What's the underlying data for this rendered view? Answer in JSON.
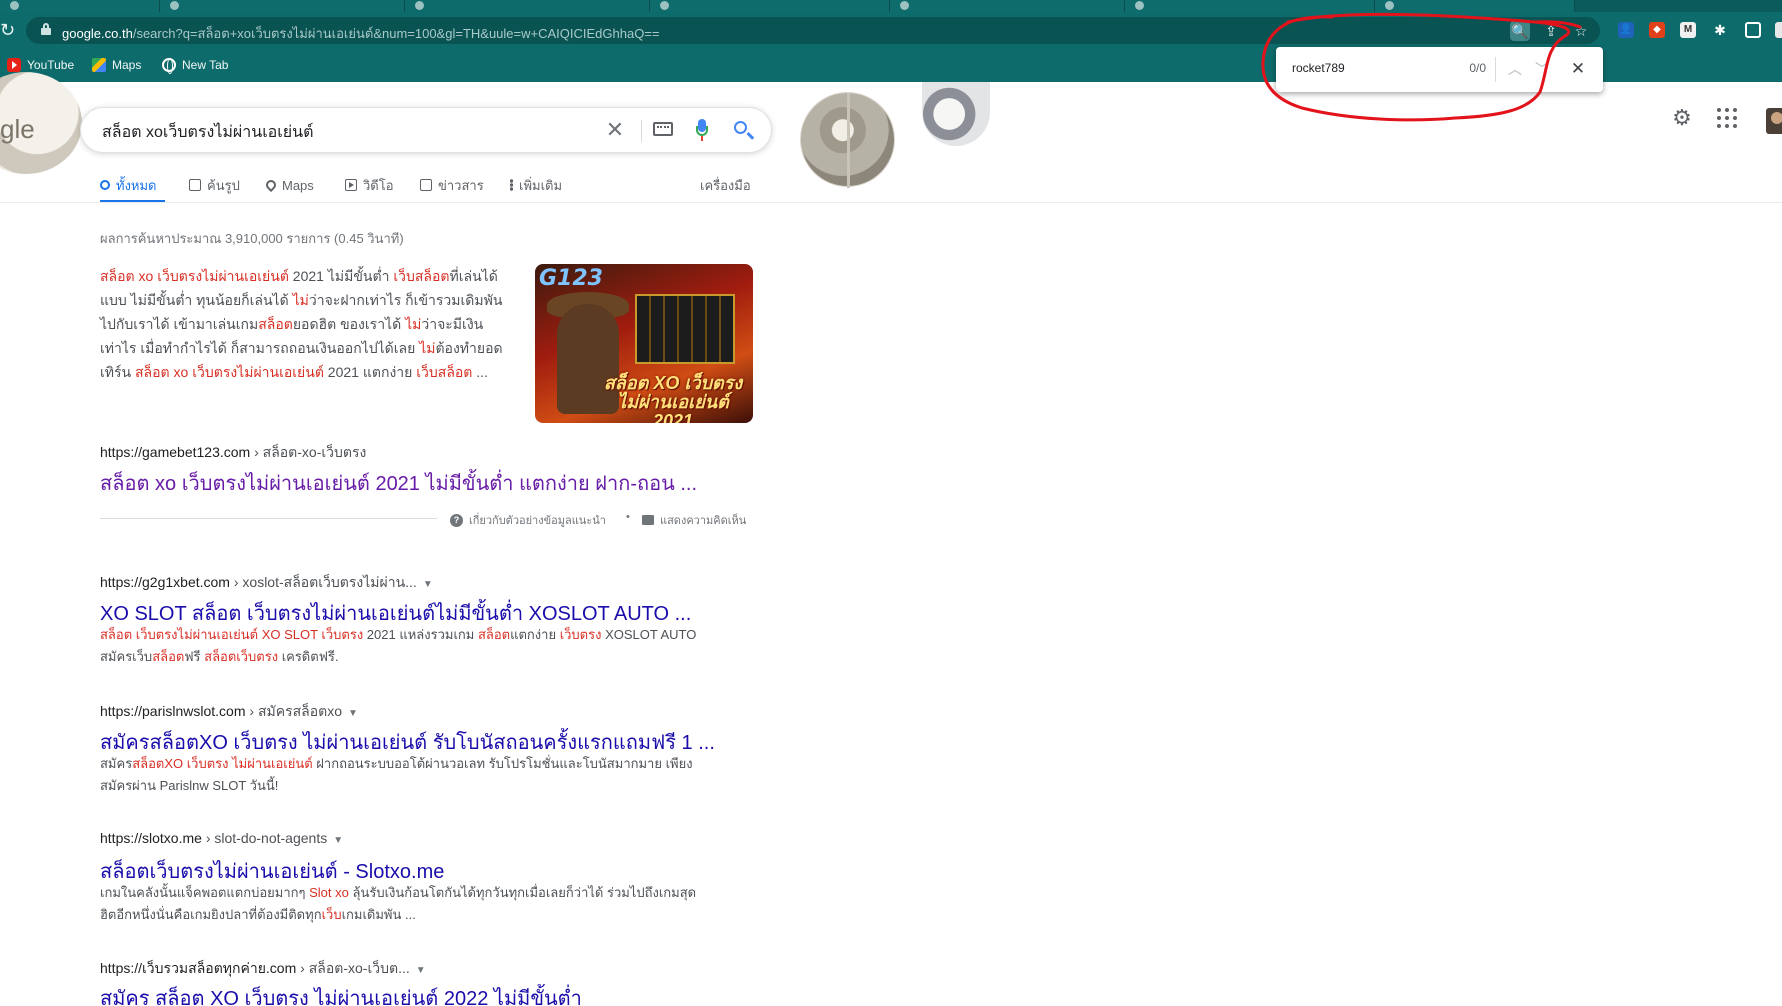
{
  "browser": {
    "url_host": "google.co.th",
    "url_rest": "/search?q=สล็อต+xoเว็บตรงไม่ผ่านเอเย่นต์&num=100&gl=TH&uule=w+CAIQICIEdGhhaQ==",
    "bookmarks": [
      {
        "label": "YouTube",
        "icon": "youtube-icon"
      },
      {
        "label": "Maps",
        "icon": "maps-icon"
      },
      {
        "label": "New Tab",
        "icon": "globe-icon"
      }
    ]
  },
  "findbar": {
    "query": "rocket789",
    "count": "0/0"
  },
  "search": {
    "query": "สล็อต xoเว็บตรงไม่ผ่านเอเย่นต์",
    "tabs": [
      {
        "label": "ทั้งหมด",
        "icon": "search-icon",
        "active": true
      },
      {
        "label": "ค้นรูป",
        "icon": "image-icon"
      },
      {
        "label": "Maps",
        "icon": "map-pin-icon"
      },
      {
        "label": "วิดีโอ",
        "icon": "video-icon"
      },
      {
        "label": "ข่าวสาร",
        "icon": "news-icon"
      },
      {
        "label": "เพิ่มเติม",
        "icon": "more-dots-icon"
      }
    ],
    "tools_label": "เครื่องมือ",
    "stats": "ผลการค้นหาประมาณ 3,910,000 รายการ (0.45 วินาที)"
  },
  "featured": {
    "snippet_segments": [
      {
        "t": "สล็อต xo เว็บตรงไม่ผ่านเอเย่นต์",
        "hl": true
      },
      {
        "t": " 2021 ไม่มีขั้นต่ำ ",
        "hl": false
      },
      {
        "t": "เว็บสล็อต",
        "hl": true
      },
      {
        "t": "ที่เล่นได้แบบ ไม่มีขั้นต่ำ ทุนน้อยก็เล่นได้ ",
        "hl": false
      },
      {
        "t": "ไม่",
        "hl": true
      },
      {
        "t": "ว่าจะฝากเท่าไร ก็เข้ารวมเดิมพันไปกับเราได้ เข้ามาเล่นเกม",
        "hl": false
      },
      {
        "t": "สล็อต",
        "hl": true
      },
      {
        "t": "ยอดฮิต ของเราได้ ",
        "hl": false
      },
      {
        "t": "ไม่",
        "hl": true
      },
      {
        "t": "ว่าจะมีเงินเท่าไร เมื่อทำกำไรได้ ก็สามารถถอนเงินออกไปได้เลย ",
        "hl": false
      },
      {
        "t": "ไม่",
        "hl": true
      },
      {
        "t": "ต้องทำยอดเทิร์น ",
        "hl": false
      },
      {
        "t": "สล็อต xo เว็บตรงไม่ผ่านเอเย่นต์",
        "hl": true
      },
      {
        "t": " 2021 แตกง่าย ",
        "hl": false
      },
      {
        "t": "เว็บสล็อต",
        "hl": true
      },
      {
        "t": " ...",
        "hl": false
      }
    ],
    "thumb_brand": "G123",
    "thumb_title": "สล็อต XO เว็บตรงไม่ผ่านเอเย่นต์ 2021",
    "cite_host": "https://gamebet123.com",
    "cite_path": " › สล็อต-xo-เว็บตรง",
    "title": "สล็อต xo เว็บตรงไม่ผ่านเอเย่นต์ 2021 ไม่มีขั้นต่ำ แตกง่าย ฝาก-ถอน ...",
    "about_label": "เกี่ยวกับตัวอย่างข้อมูลแนะนำ",
    "feedback_label": "แสดงความคิดเห็น",
    "dot": "•"
  },
  "results": [
    {
      "cite_host": "https://g2g1xbet.com",
      "cite_path": " › xoslot-สล็อตเว็บตรงไม่ผ่าน...",
      "title": "XO SLOT สล็อต เว็บตรงไม่ผ่านเอเย่นต์ไม่มีขั้นต่ำ XOSLOT AUTO ...",
      "desc": [
        {
          "t": "สล็อต เว็บตรงไม่ผ่านเอเย่นต์ XO SLOT เว็บตรง",
          "hl": true
        },
        {
          "t": " 2021 แหล่งรวมเกม ",
          "hl": false
        },
        {
          "t": "สล็อต",
          "hl": true
        },
        {
          "t": "แตกง่าย ",
          "hl": false
        },
        {
          "t": "เว็บตรง",
          "hl": true
        },
        {
          "t": " XOSLOT AUTO สมัครเว็บ",
          "hl": false
        },
        {
          "t": "สล็อต",
          "hl": true
        },
        {
          "t": "ฟรี ",
          "hl": false
        },
        {
          "t": "สล็อตเว็บตรง",
          "hl": true
        },
        {
          "t": " เครดิตฟรี.",
          "hl": false
        }
      ]
    },
    {
      "cite_host": "https://parislnwslot.com",
      "cite_path": " › สมัครสล็อตxo",
      "title": "สมัครสล็อตXO เว็บตรง ไม่ผ่านเอเย่นต์ รับโบนัสถอนครั้งแรกแถมฟรี 1 ...",
      "desc": [
        {
          "t": "สมัคร",
          "hl": false
        },
        {
          "t": "สล็อตXO เว็บตรง ไม่ผ่านเอเย่นต์",
          "hl": true
        },
        {
          "t": " ฝากถอนระบบออโต้ผ่านวอเลท รับโปรโมชั่นและโบนัสมากมาย เพียงสมัครผ่าน Parislnw SLOT วันนี้!",
          "hl": false
        }
      ]
    },
    {
      "cite_host": "https://slotxo.me",
      "cite_path": " › slot-do-not-agents",
      "title": "สล็อตเว็บตรงไม่ผ่านเอเย่นต์ - Slotxo.me",
      "desc": [
        {
          "t": "เกมในคลังนั้นแจ็คพอตแตกบ่อยมากๆ ",
          "hl": false
        },
        {
          "t": "Slot xo",
          "hl": true
        },
        {
          "t": " ลุ้นรับเงินก้อนโตกันได้ทุกวันทุกเมื่อเลยก็ว่าได้ ร่วมไปถึงเกมสุดฮิตอีกหนึ่งนั่นคือเกมยิงปลาที่ต้องมีติดทุก",
          "hl": false
        },
        {
          "t": "เว็บ",
          "hl": true
        },
        {
          "t": "เกมเดิมพัน ...",
          "hl": false
        }
      ]
    },
    {
      "cite_host": "https://เว็บรวมสล็อตทุกค่าย.com",
      "cite_path": " › สล็อต-xo-เว็บต...",
      "title": "สมัคร สล็อต XO เว็บตรง ไม่ผ่านเอเย่นต์ 2022 ไม่มีขั้นต่ำ",
      "desc": []
    }
  ],
  "colors": {
    "chrome_teal": "#0e6b6b",
    "link_blue": "#1a0dab",
    "visited_purple": "#681da8",
    "highlight_red": "#d93025",
    "annotation_red": "#e2131b"
  }
}
